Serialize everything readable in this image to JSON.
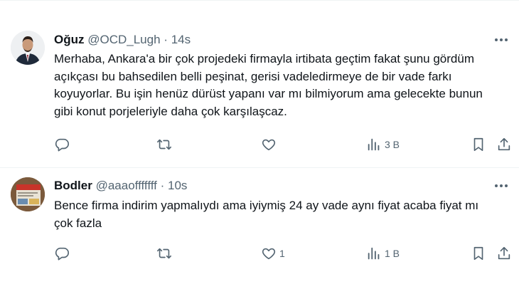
{
  "tweets": [
    {
      "name": "Oğuz",
      "handle": "@OCD_Lugh",
      "separator": "·",
      "time": "14s",
      "text": "Merhaba, Ankara'a bir çok projedeki firmayla irtibata geçtim fakat şunu gördüm açıkçası bu bahsedilen belli peşinat, gerisi vadeledirmeye de bir vade farkı koyuyorlar. Bu işin henüz dürüst yapanı var mı bilmiyorum ama gelecekte bunun gibi konut porjeleriyle daha çok karşılaşcaz.",
      "replies": "",
      "retweets": "",
      "likes": "",
      "views": "3 B",
      "avatar_icon": "person-avatar"
    },
    {
      "name": "Bodler",
      "handle": "@aaaofffffff",
      "separator": "·",
      "time": "10s",
      "text": "Bence firma indirim yapmalıydı ama iyiymiş 24 ay vade aynı fiyat acaba fiyat mı çok fazla",
      "replies": "",
      "retweets": "",
      "likes": "1",
      "views": "1 B",
      "avatar_icon": "brochure-avatar"
    }
  ],
  "icons": {
    "more": "more-horizontal-icon",
    "reply": "reply-icon",
    "retweet": "retweet-icon",
    "like": "heart-icon",
    "views": "views-bar-chart-icon",
    "bookmark": "bookmark-icon",
    "share": "share-icon"
  },
  "colors": {
    "text": "#0f1419",
    "secondary": "#536471",
    "divider": "#eff3f4"
  }
}
